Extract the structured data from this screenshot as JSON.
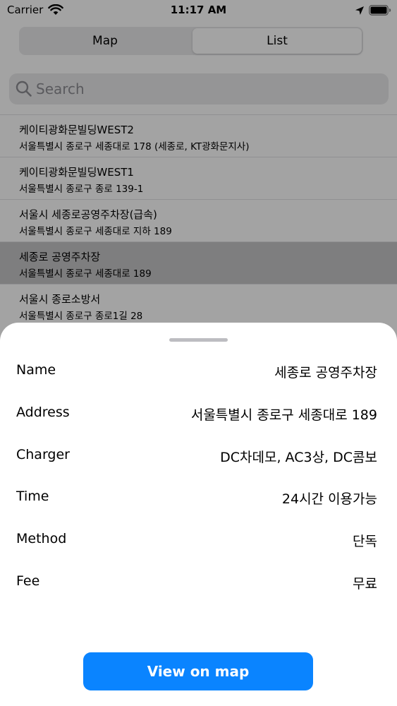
{
  "status_bar": {
    "carrier": "Carrier",
    "time": "11:17 AM"
  },
  "segmented": {
    "items": [
      {
        "label": "Map"
      },
      {
        "label": "List"
      }
    ],
    "selected": "List"
  },
  "search": {
    "placeholder": "Search"
  },
  "results": [
    {
      "title": "케이티광화문빌딩WEST2",
      "subtitle": "서울특별시 종로구 세종대로 178 (세종로, KT광화문지사)"
    },
    {
      "title": "케이티광화문빌딩WEST1",
      "subtitle": "서울특별시 종로구 종로 139-1"
    },
    {
      "title": "서울시 세종로공영주차장(급속)",
      "subtitle": "서울특별시 종로구 세종대로 지하 189"
    },
    {
      "title": "세종로 공영주차장",
      "subtitle": "서울특별시 종로구 세종대로 189"
    },
    {
      "title": "서울시 종로소방서",
      "subtitle": "서울특별시 종로구 종로1길 28"
    }
  ],
  "sheet": {
    "details": [
      {
        "label": "Name",
        "value": "세종로 공영주차장"
      },
      {
        "label": "Address",
        "value": "서울특별시 종로구 세종대로 189"
      },
      {
        "label": "Charger",
        "value": "DC차데모, AC3상, DC콤보"
      },
      {
        "label": "Time",
        "value": "24시간 이용가능"
      },
      {
        "label": "Method",
        "value": "단독"
      },
      {
        "label": "Fee",
        "value": "무료"
      }
    ],
    "button_label": "View on map"
  },
  "colors": {
    "accent": "#0a84ff",
    "selected_row": "#c5c5c7",
    "segment_bg": "#e9e9eb"
  },
  "icons": {
    "wifi": "wifi-icon",
    "location": "location-arrow-icon",
    "battery": "battery-icon",
    "search": "search-icon"
  }
}
